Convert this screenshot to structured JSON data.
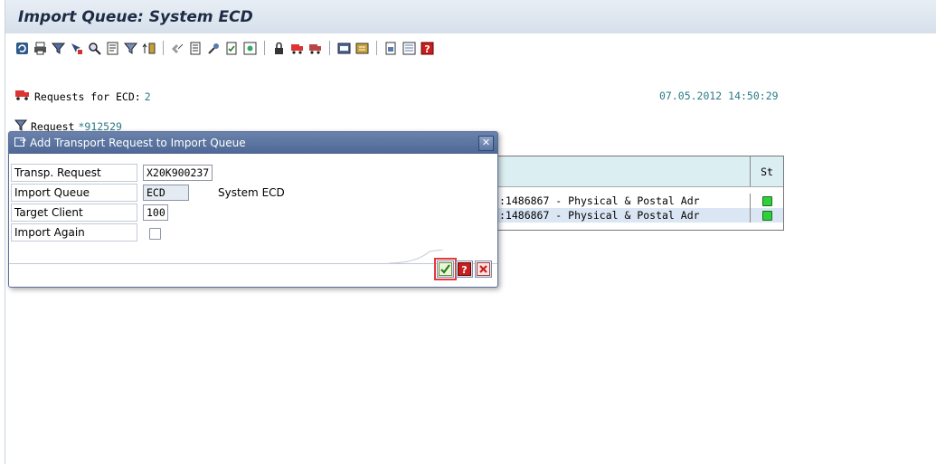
{
  "window": {
    "title": "Import Queue: System ECD"
  },
  "toolbar": {
    "icons": [
      "refresh-icon",
      "print-icon",
      "filter-icon",
      "select-icon",
      "zoom-icon",
      "detail-icon",
      "filter-funnel-icon",
      "sort-icon",
      "find-icon",
      "log-icon",
      "tools-icon",
      "check-icon",
      "status-icon",
      "lock-icon",
      "truck-icon",
      "truck-all-icon",
      "queue-icon",
      "settings-icon",
      "transport-icon",
      "list-icon",
      "help-icon"
    ]
  },
  "header": {
    "requests_label": "Requests for ECD:",
    "requests_count": "2",
    "datetime": "07.05.2012 14:50:29",
    "filter_label": "Request",
    "filter_value": "*912529"
  },
  "table": {
    "status_header": "St",
    "rows": [
      {
        "text": ":1486867 - Physical & Postal Adr",
        "status": "green"
      },
      {
        "text": ":1486867 - Physical & Postal Adr",
        "status": "green"
      }
    ]
  },
  "dialog": {
    "title": "Add Transport Request to Import Queue",
    "fields": {
      "transp_request_label": "Transp. Request",
      "transp_request_value": "X20K900237",
      "import_queue_label": "Import Queue",
      "import_queue_value": "ECD",
      "import_queue_desc": "System ECD",
      "target_client_label": "Target Client",
      "target_client_value": "100",
      "import_again_label": "Import Again"
    },
    "close_glyph": "✕"
  },
  "colors": {
    "accent": "#4e6796",
    "link": "#2a7a86",
    "status_green": "#2ed13a"
  }
}
